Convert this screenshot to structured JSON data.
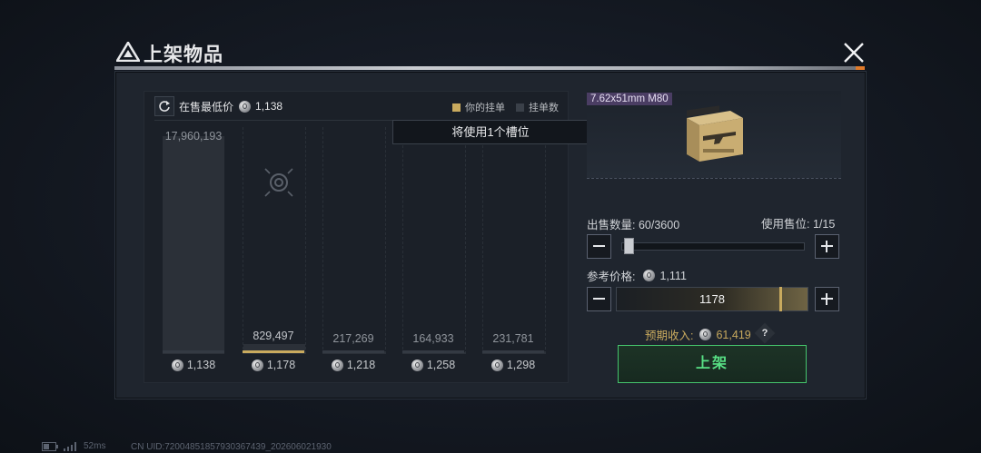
{
  "dialog": {
    "title": "上架物品"
  },
  "chart_panel": {
    "lowest_label": "在售最低价",
    "lowest_price": "1,138",
    "legend": [
      {
        "label": "你的挂单",
        "color": "#c9aa5e"
      },
      {
        "label": "挂单数",
        "color": "#3a4049"
      }
    ],
    "tooltip": "将使用1个槽位"
  },
  "chart_data": {
    "type": "bar",
    "categories": [
      "1,138",
      "1,178",
      "1,218",
      "1,258",
      "1,298"
    ],
    "values": [
      17960193,
      829497,
      217269,
      164933,
      231781
    ],
    "value_labels": [
      "17,960,193",
      "829,497",
      "217,269",
      "164,933",
      "231,781"
    ],
    "highlight_index": 1,
    "legend": [
      "你的挂单",
      "挂单数"
    ]
  },
  "item": {
    "name": "7.62x51mm M80"
  },
  "sell": {
    "quantity_label": "出售数量:",
    "quantity_value": "60/3600",
    "slots_label": "使用售位:",
    "slots_value": "1/15",
    "quantity_fraction": 0.0167,
    "ref_price_label": "参考价格:",
    "ref_price_value": "1,111",
    "price_input": "1178",
    "income_label": "预期收入:",
    "income_value": "61,419",
    "help": "?",
    "list_button": "上架"
  },
  "status": {
    "ping": "52ms",
    "uid": "CN UID:72004851857930367439_202606021930"
  }
}
